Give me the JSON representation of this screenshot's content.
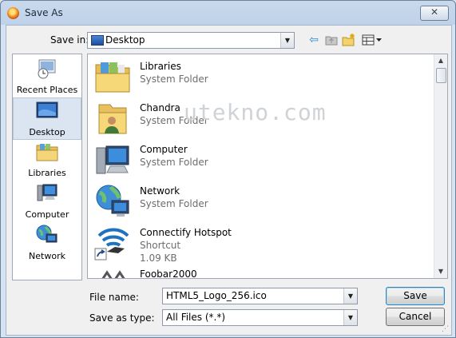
{
  "window": {
    "title": "Save As",
    "close_label": "✕"
  },
  "toolbar": {
    "save_in_label": "Save in:",
    "location_value": "Desktop",
    "buttons": [
      "back-icon",
      "up-folder-icon",
      "new-folder-icon",
      "view-menu-icon"
    ]
  },
  "places": [
    {
      "label": "Recent Places",
      "icon": "recent-places-icon",
      "selected": false
    },
    {
      "label": "Desktop",
      "icon": "desktop-icon",
      "selected": true
    },
    {
      "label": "Libraries",
      "icon": "libraries-icon",
      "selected": false
    },
    {
      "label": "Computer",
      "icon": "computer-icon",
      "selected": false
    },
    {
      "label": "Network",
      "icon": "network-icon",
      "selected": false
    }
  ],
  "files": [
    {
      "name": "Libraries",
      "type": "System Folder",
      "icon": "libraries-folder-icon"
    },
    {
      "name": "Chandra",
      "type": "System Folder",
      "icon": "user-folder-icon"
    },
    {
      "name": "Computer",
      "type": "System Folder",
      "icon": "computer-icon"
    },
    {
      "name": "Network",
      "type": "System Folder",
      "icon": "network-icon"
    },
    {
      "name": "Connectify Hotspot",
      "type": "Shortcut",
      "size": "1.09 KB",
      "icon": "wifi-shortcut-icon"
    },
    {
      "name": "Foobar2000",
      "type": "",
      "icon": "foobar-icon"
    }
  ],
  "watermark": "utekno.com",
  "form": {
    "file_name_label": "File name:",
    "file_name_value": "HTML5_Logo_256.ico",
    "save_type_label": "Save as type:",
    "save_type_value": "All Files (*.*)",
    "save_button": "Save",
    "cancel_button": "Cancel"
  }
}
